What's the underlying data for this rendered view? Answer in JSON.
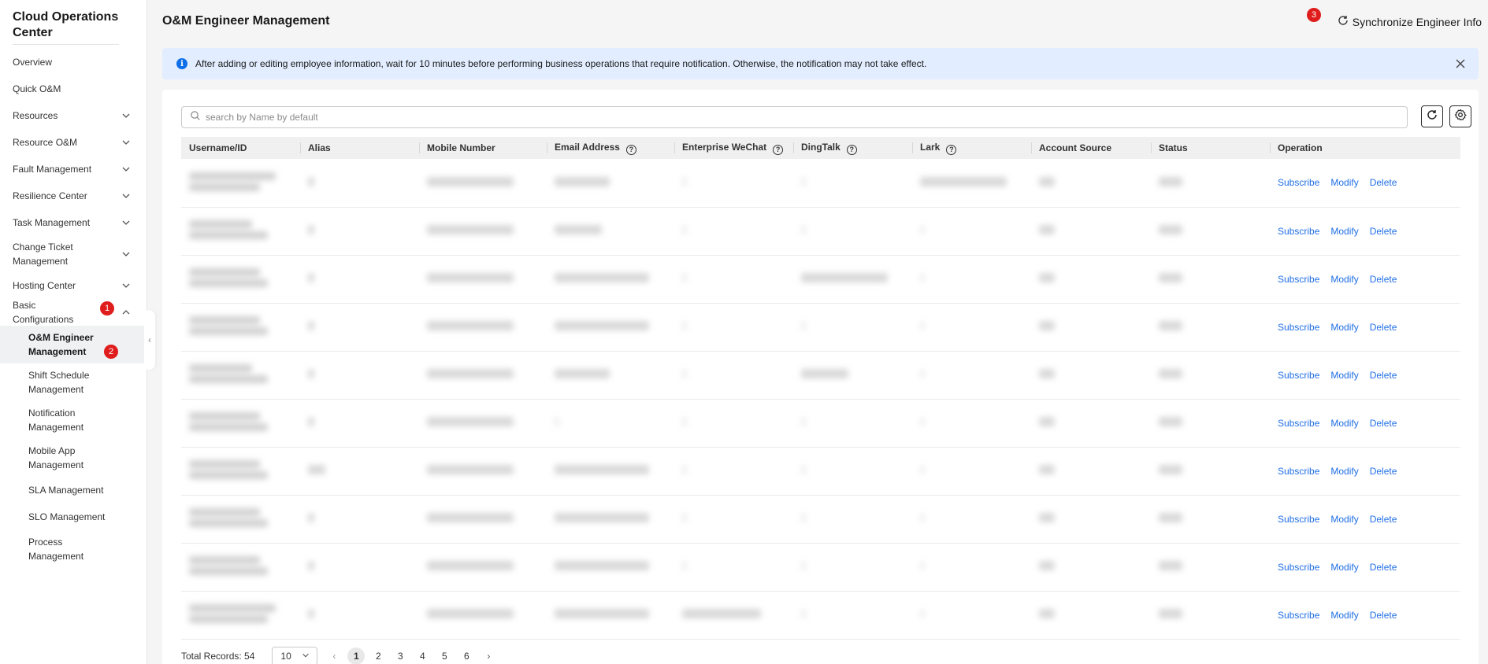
{
  "sidebar": {
    "title": "Cloud Operations Center",
    "items": [
      {
        "label": "Overview"
      },
      {
        "label": "Quick O&M"
      },
      {
        "label": "Resources"
      },
      {
        "label": "Resource O&M"
      },
      {
        "label": "Fault Management"
      },
      {
        "label": "Resilience Center"
      },
      {
        "label": "Task Management"
      },
      {
        "label": "Change Ticket Management"
      },
      {
        "label": "Hosting Center"
      },
      {
        "label": "Basic Configurations"
      }
    ],
    "subitems": [
      {
        "label": "O&M Engineer Management"
      },
      {
        "label": "Shift Schedule Management"
      },
      {
        "label": "Notification Management"
      },
      {
        "label": "Mobile App Management"
      },
      {
        "label": "SLA Management"
      },
      {
        "label": "SLO Management"
      },
      {
        "label": "Process Management"
      }
    ],
    "badges": {
      "basic_config": "1",
      "engineer_mgmt": "2"
    }
  },
  "header": {
    "title": "O&M Engineer Management",
    "sync_label": "Synchronize Engineer Info",
    "badge": "3"
  },
  "alert": {
    "text": "After adding or editing employee information, wait for 10 minutes before performing business operations that require notification. Otherwise, the notification may not take effect."
  },
  "search": {
    "placeholder": "search by Name by default"
  },
  "table": {
    "columns": [
      "Username/ID",
      "Alias",
      "Mobile Number",
      "Email Address",
      "Enterprise WeChat",
      "DingTalk",
      "Lark",
      "Account Source",
      "Status",
      "Operation"
    ],
    "operations": {
      "subscribe": "Subscribe",
      "modify": "Modify",
      "delete": "Delete"
    }
  },
  "footer": {
    "total": "Total Records: 54",
    "page_size": "10",
    "pages": [
      "1",
      "2",
      "3",
      "4",
      "5",
      "6"
    ],
    "current_page": "1"
  },
  "colors": {
    "accent": "#1f6fe5",
    "badge": "#e01d1d",
    "alert_bg": "#e2edff"
  }
}
